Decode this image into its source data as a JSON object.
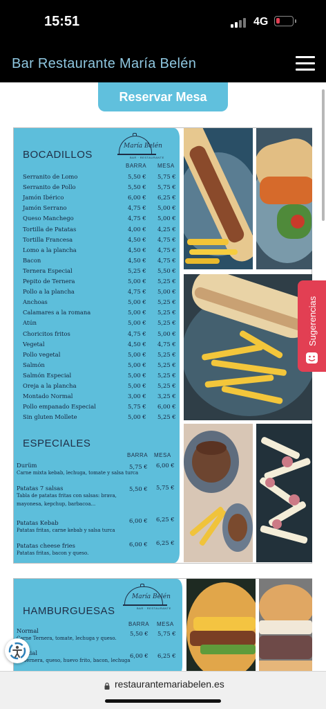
{
  "status_bar": {
    "time": "15:51",
    "network": "4G",
    "battery_color": "#e23f53"
  },
  "header": {
    "title": "Bar Restaurante María Belén",
    "menu_icon": "hamburger-icon"
  },
  "reserve_button": {
    "label": "Reservar Mesa"
  },
  "logo": {
    "name": "María Belén",
    "subtitle": "BAR · RESTAURANTE"
  },
  "bocadillos": {
    "title": "BOCADILLOS",
    "col_barra": "BARRA",
    "col_mesa": "MESA",
    "items": [
      {
        "name": "Serranito de Lomo",
        "barra": "5,50 €",
        "mesa": "5,75 €"
      },
      {
        "name": "Serranito de Pollo",
        "barra": "5,50 €",
        "mesa": "5,75 €"
      },
      {
        "name": "Jamón Ibérico",
        "barra": "6,00 €",
        "mesa": "6,25 €"
      },
      {
        "name": "Jamón Serrano",
        "barra": "4,75 €",
        "mesa": "5,00 €"
      },
      {
        "name": "Queso Manchego",
        "barra": "4,75 €",
        "mesa": "5,00 €"
      },
      {
        "name": "Tortilla de Patatas",
        "barra": "4,00 €",
        "mesa": "4,25 €"
      },
      {
        "name": "Tortilla Francesa",
        "barra": "4,50 €",
        "mesa": "4,75 €"
      },
      {
        "name": "Lomo a la plancha",
        "barra": "4,50 €",
        "mesa": "4,75 €"
      },
      {
        "name": "Bacon",
        "barra": "4,50 €",
        "mesa": "4,75 €"
      },
      {
        "name": "Ternera Especial",
        "barra": "5,25 €",
        "mesa": "5,50 €"
      },
      {
        "name": "Pepito de Ternera",
        "barra": "5,00 €",
        "mesa": "5,25 €"
      },
      {
        "name": "Pollo a la plancha",
        "barra": "4,75 €",
        "mesa": "5,00 €"
      },
      {
        "name": "Anchoas",
        "barra": "5,00 €",
        "mesa": "5,25 €"
      },
      {
        "name": "Calamares a la romana",
        "barra": "5,00 €",
        "mesa": "5,25 €"
      },
      {
        "name": "Atún",
        "barra": "5,00 €",
        "mesa": "5,25 €"
      },
      {
        "name": "Choricitos fritos",
        "barra": "4,75 €",
        "mesa": "5,00 €"
      },
      {
        "name": "Vegetal",
        "barra": "4,50 €",
        "mesa": "4,75 €"
      },
      {
        "name": "Pollo vegetal",
        "barra": "5,00 €",
        "mesa": "5,25 €"
      },
      {
        "name": "Salmón",
        "barra": "5,00 €",
        "mesa": "5,25 €"
      },
      {
        "name": "Salmón Especial",
        "barra": "5,00 €",
        "mesa": "5,25 €"
      },
      {
        "name": "Oreja a la plancha",
        "barra": "5,00 €",
        "mesa": "5,25 €"
      },
      {
        "name": "Montado Normal",
        "barra": "3,00 €",
        "mesa": "3,25 €"
      },
      {
        "name": "Pollo empanado Especial",
        "barra": "5,75 €",
        "mesa": "6,00 €"
      },
      {
        "name": "Sin gluten Mollete",
        "barra": "5,00 €",
        "mesa": "5,25 €"
      }
    ]
  },
  "especiales": {
    "title": "ESPECIALES",
    "col_barra": "BARRA",
    "col_mesa": "MESA",
    "items": [
      {
        "name": "Durüm",
        "desc": "Carne mixta kebab, lechuga, tomate y salsa turca",
        "barra": "5,75 €",
        "mesa": "6,00 €"
      },
      {
        "name": "Patatas 7 salsas",
        "desc": "Tabla de patatas fritas con salsas: brava, mayonesa, kepchup, barbacoa...",
        "barra": "5,50 €",
        "mesa": "5,75 €"
      },
      {
        "name": "Patatas Kebab",
        "desc": "Patatas fritas, carne kebab y salsa turca",
        "barra": "6,00 €",
        "mesa": "6,25 €"
      },
      {
        "name": "Patatas cheese fries",
        "desc": "Patatas fritas, bacon y queso.",
        "barra": "6,00 €",
        "mesa": "6,25 €"
      }
    ]
  },
  "hamburguesas": {
    "title": "HAMBURGUESAS",
    "col_barra": "BARRA",
    "col_mesa": "MESA",
    "items": [
      {
        "name": "Normal",
        "desc": "Carne Ternera, tomate, lechuga y queso.",
        "barra": "5,50 €",
        "mesa": "5,75 €"
      },
      {
        "name": "ecial",
        "desc": "Ternera, queso, huevo frito, bacon, lechuga",
        "barra": "6,00 €",
        "mesa": "6,25 €"
      }
    ]
  },
  "suggestions_tab": {
    "label": "Sugerencias"
  },
  "url_bar": {
    "url": "restaurantemariabelen.es"
  }
}
